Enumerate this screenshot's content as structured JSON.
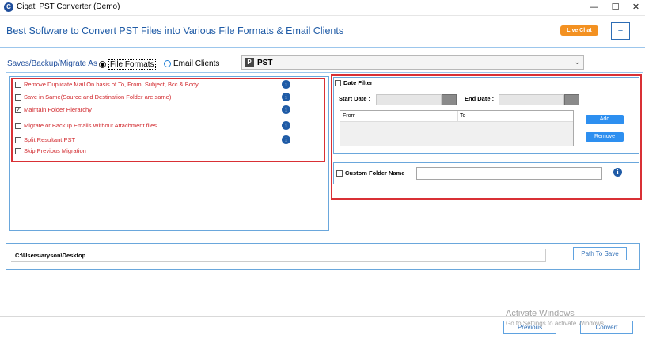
{
  "window": {
    "app_icon_letter": "C",
    "title": "Cigati PST Converter (Demo)",
    "minimize": "—",
    "maximize": "☐",
    "close": "✕"
  },
  "banner": {
    "title": "Best Software to Convert PST Files into Various File Formats & Email Clients",
    "live_chat": "Live Chat",
    "menu_icon": "≡"
  },
  "save_as": {
    "label": "Saves/Backup/Migrate As",
    "options": [
      {
        "label": "File Formats",
        "selected": true
      },
      {
        "label": "Email Clients",
        "selected": false
      }
    ],
    "format_icon": "P",
    "format_value": "PST",
    "arrow": "⌄"
  },
  "options": {
    "items": [
      {
        "label": "Remove Duplicate Mail On basis of To, From, Subject, Bcc & Body",
        "checked": false,
        "info": true
      },
      {
        "label": "Save in Same(Source and Destination Folder are same)",
        "checked": false,
        "info": true
      },
      {
        "label": "Maintain Folder Hierarchy",
        "checked": true,
        "info": true
      },
      {
        "label": "Migrate or Backup Emails Without Attachment files",
        "checked": false,
        "info": true
      },
      {
        "label": "Split Resultant PST",
        "checked": false,
        "info": true
      },
      {
        "label": "Skip Previous Migration",
        "checked": false,
        "info": false
      }
    ],
    "info_glyph": "i"
  },
  "date_filter": {
    "label": "Date Filter",
    "start_label": "Start Date :",
    "end_label": "End Date :",
    "col_from": "From",
    "col_to": "To",
    "add": "Add",
    "remove": "Remove"
  },
  "custom_folder": {
    "label": "Custom Folder Name",
    "value": ""
  },
  "path": {
    "value": "C:\\Users\\aryson\\Desktop",
    "button": "Path To Save"
  },
  "footer": {
    "previous": "Previous",
    "convert": "Convert",
    "watermark_title": "Activate Windows",
    "watermark_sub": "Go to Settings to activate Windows."
  },
  "colors": {
    "accent_blue": "#1f5ba6",
    "red_highlight": "#d93035",
    "live_chat_orange": "#f39121",
    "button_blue": "#2d8ff0"
  }
}
